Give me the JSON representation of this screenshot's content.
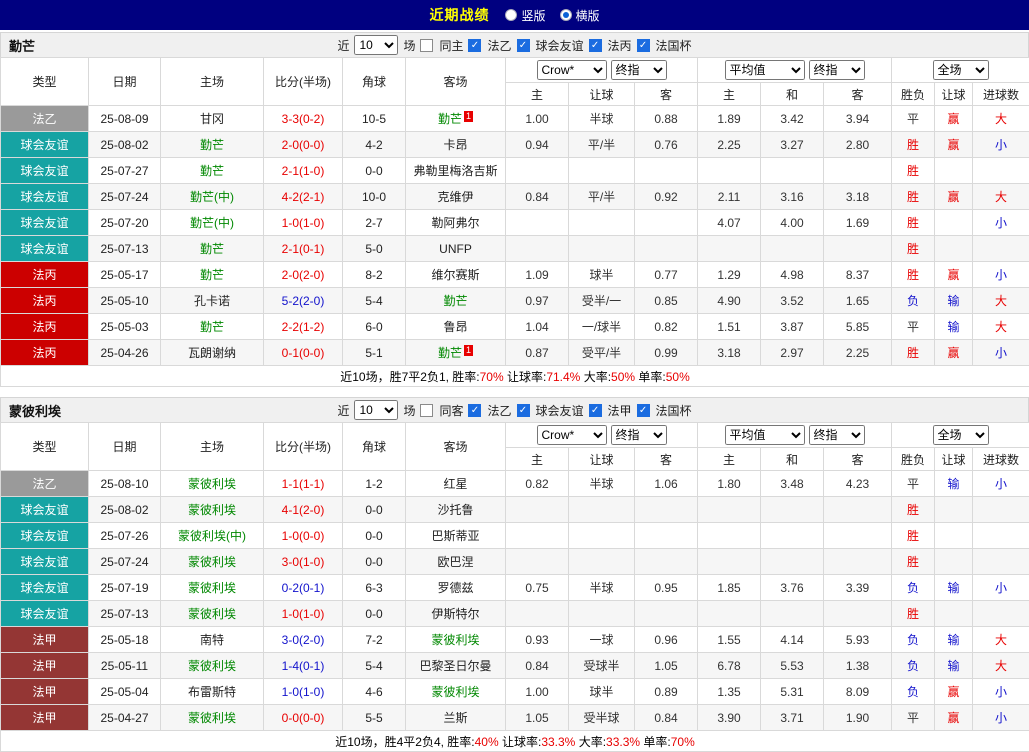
{
  "title_bar": {
    "title": "近期战绩",
    "view_options": [
      {
        "label": "竖版",
        "selected": false
      },
      {
        "label": "横版",
        "selected": true
      }
    ]
  },
  "colors": {
    "navy": "#000080",
    "title_yellow": "#ffff00",
    "red": "#e80000",
    "blue": "#1212cc",
    "green": "#008800",
    "league": {
      "法乙": "#9a9a9a",
      "球会友谊": "#16a3a3",
      "法丙": "#cc0000",
      "法甲": "#943634"
    }
  },
  "table_header": {
    "main_columns": [
      "类型",
      "日期",
      "主场",
      "比分(半场)",
      "角球",
      "客场"
    ],
    "sub_columns": [
      "主",
      "让球",
      "客",
      "主",
      "和",
      "客",
      "胜负",
      "让球",
      "进球数"
    ],
    "odds_selects_1": [
      "Crow*",
      "终指"
    ],
    "odds_selects_2": [
      "平均值",
      "终指"
    ],
    "odds_selects_3": [
      "全场"
    ]
  },
  "sections": [
    {
      "team": "勤芒",
      "filter": {
        "near_label": "近",
        "games": "10",
        "games_label": "场",
        "same_label": "同主",
        "same_checked": false,
        "leagues": [
          {
            "label": "法乙",
            "checked": true
          },
          {
            "label": "球会友谊",
            "checked": true
          },
          {
            "label": "法丙",
            "checked": true
          },
          {
            "label": "法国杯",
            "checked": true
          }
        ]
      },
      "rows": [
        {
          "league": "法乙",
          "date": "25-08-09",
          "home": "甘冈",
          "hf": false,
          "score": "3-3(0-2)",
          "corner": "10-5",
          "away": "勤芒",
          "af": true,
          "ac": "1",
          "o1": [
            "1.00",
            "半球",
            "0.88"
          ],
          "o2": [
            "1.89",
            "3.42",
            "3.94"
          ],
          "wdl": "平",
          "let": "赢",
          "goal": "大"
        },
        {
          "league": "球会友谊",
          "date": "25-08-02",
          "home": "勤芒",
          "hf": true,
          "score": "2-0(0-0)",
          "corner": "4-2",
          "away": "卡昂",
          "af": false,
          "o1": [
            "0.94",
            "平/半",
            "0.76"
          ],
          "o2": [
            "2.25",
            "3.27",
            "2.80"
          ],
          "wdl": "胜",
          "let": "赢",
          "goal": "小"
        },
        {
          "league": "球会友谊",
          "date": "25-07-27",
          "home": "勤芒",
          "hf": true,
          "score": "2-1(1-0)",
          "corner": "0-0",
          "away": "弗勒里梅洛吉斯",
          "af": false,
          "o1": [
            "",
            "",
            ""
          ],
          "o2": [
            "",
            "",
            ""
          ],
          "wdl": "胜",
          "let": "",
          "goal": ""
        },
        {
          "league": "球会友谊",
          "date": "25-07-24",
          "home": "勤芒(中)",
          "hf": true,
          "score": "4-2(2-1)",
          "corner": "10-0",
          "away": "克维伊",
          "af": false,
          "o1": [
            "0.84",
            "平/半",
            "0.92"
          ],
          "o2": [
            "2.11",
            "3.16",
            "3.18"
          ],
          "wdl": "胜",
          "let": "赢",
          "goal": "大"
        },
        {
          "league": "球会友谊",
          "date": "25-07-20",
          "home": "勤芒(中)",
          "hf": true,
          "score": "1-0(1-0)",
          "corner": "2-7",
          "away": "勒阿弗尔",
          "af": false,
          "o1": [
            "",
            "",
            ""
          ],
          "o2": [
            "4.07",
            "4.00",
            "1.69"
          ],
          "wdl": "胜",
          "let": "",
          "goal": "小"
        },
        {
          "league": "球会友谊",
          "date": "25-07-13",
          "home": "勤芒",
          "hf": true,
          "score": "2-1(0-1)",
          "corner": "5-0",
          "away": "UNFP",
          "af": false,
          "o1": [
            "",
            "",
            ""
          ],
          "o2": [
            "",
            "",
            ""
          ],
          "wdl": "胜",
          "let": "",
          "goal": ""
        },
        {
          "league": "法丙",
          "date": "25-05-17",
          "home": "勤芒",
          "hf": true,
          "score": "2-0(2-0)",
          "corner": "8-2",
          "away": "维尔赛斯",
          "af": false,
          "o1": [
            "1.09",
            "球半",
            "0.77"
          ],
          "o2": [
            "1.29",
            "4.98",
            "8.37"
          ],
          "wdl": "胜",
          "let": "赢",
          "goal": "小"
        },
        {
          "league": "法丙",
          "date": "25-05-10",
          "home": "孔卡诺",
          "hf": false,
          "score": "5-2(2-0)",
          "corner": "5-4",
          "away": "勤芒",
          "af": true,
          "o1": [
            "0.97",
            "受半/一",
            "0.85"
          ],
          "o2": [
            "4.90",
            "3.52",
            "1.65"
          ],
          "wdl": "负",
          "let": "输",
          "goal": "大"
        },
        {
          "league": "法丙",
          "date": "25-05-03",
          "home": "勤芒",
          "hf": true,
          "score": "2-2(1-2)",
          "corner": "6-0",
          "away": "鲁昂",
          "af": false,
          "o1": [
            "1.04",
            "一/球半",
            "0.82"
          ],
          "o2": [
            "1.51",
            "3.87",
            "5.85"
          ],
          "wdl": "平",
          "let": "输",
          "goal": "大"
        },
        {
          "league": "法丙",
          "date": "25-04-26",
          "home": "瓦朗谢纳",
          "hf": false,
          "score": "0-1(0-0)",
          "corner": "5-1",
          "away": "勤芒",
          "af": true,
          "ac": "1",
          "o1": [
            "0.87",
            "受平/半",
            "0.99"
          ],
          "o2": [
            "3.18",
            "2.97",
            "2.25"
          ],
          "wdl": "胜",
          "let": "赢",
          "goal": "小"
        }
      ],
      "summary": [
        {
          "text": "近10场，胜7平2负1, 胜率:",
          "type": "dark"
        },
        {
          "text": "70%",
          "type": "red"
        },
        {
          "text": " 让球率:",
          "type": "dark"
        },
        {
          "text": "71.4%",
          "type": "red"
        },
        {
          "text": " 大率:",
          "type": "dark"
        },
        {
          "text": "50%",
          "type": "red"
        },
        {
          "text": " 单率:",
          "type": "dark"
        },
        {
          "text": "50%",
          "type": "red"
        }
      ]
    },
    {
      "team": "蒙彼利埃",
      "filter": {
        "near_label": "近",
        "games": "10",
        "games_label": "场",
        "same_label": "同客",
        "same_checked": false,
        "leagues": [
          {
            "label": "法乙",
            "checked": true
          },
          {
            "label": "球会友谊",
            "checked": true
          },
          {
            "label": "法甲",
            "checked": true
          },
          {
            "label": "法国杯",
            "checked": true
          }
        ]
      },
      "rows": [
        {
          "league": "法乙",
          "date": "25-08-10",
          "home": "蒙彼利埃",
          "hf": true,
          "score": "1-1(1-1)",
          "corner": "1-2",
          "away": "红星",
          "af": false,
          "o1": [
            "0.82",
            "半球",
            "1.06"
          ],
          "o2": [
            "1.80",
            "3.48",
            "4.23"
          ],
          "wdl": "平",
          "let": "输",
          "goal": "小"
        },
        {
          "league": "球会友谊",
          "date": "25-08-02",
          "home": "蒙彼利埃",
          "hf": true,
          "score": "4-1(2-0)",
          "corner": "0-0",
          "away": "沙托鲁",
          "af": false,
          "o1": [
            "",
            "",
            ""
          ],
          "o2": [
            "",
            "",
            ""
          ],
          "wdl": "胜",
          "let": "",
          "goal": ""
        },
        {
          "league": "球会友谊",
          "date": "25-07-26",
          "home": "蒙彼利埃(中)",
          "hf": true,
          "score": "1-0(0-0)",
          "corner": "0-0",
          "away": "巴斯蒂亚",
          "af": false,
          "o1": [
            "",
            "",
            ""
          ],
          "o2": [
            "",
            "",
            ""
          ],
          "wdl": "胜",
          "let": "",
          "goal": ""
        },
        {
          "league": "球会友谊",
          "date": "25-07-24",
          "home": "蒙彼利埃",
          "hf": true,
          "score": "3-0(1-0)",
          "corner": "0-0",
          "away": "欧巴涅",
          "af": false,
          "o1": [
            "",
            "",
            ""
          ],
          "o2": [
            "",
            "",
            ""
          ],
          "wdl": "胜",
          "let": "",
          "goal": ""
        },
        {
          "league": "球会友谊",
          "date": "25-07-19",
          "home": "蒙彼利埃",
          "hf": true,
          "score": "0-2(0-1)",
          "corner": "6-3",
          "away": "罗德兹",
          "af": false,
          "o1": [
            "0.75",
            "半球",
            "0.95"
          ],
          "o2": [
            "1.85",
            "3.76",
            "3.39"
          ],
          "wdl": "负",
          "let": "输",
          "goal": "小"
        },
        {
          "league": "球会友谊",
          "date": "25-07-13",
          "home": "蒙彼利埃",
          "hf": true,
          "score": "1-0(1-0)",
          "corner": "0-0",
          "away": "伊斯特尔",
          "af": false,
          "o1": [
            "",
            "",
            ""
          ],
          "o2": [
            "",
            "",
            ""
          ],
          "wdl": "胜",
          "let": "",
          "goal": ""
        },
        {
          "league": "法甲",
          "date": "25-05-18",
          "home": "南特",
          "hf": false,
          "score": "3-0(2-0)",
          "corner": "7-2",
          "away": "蒙彼利埃",
          "af": true,
          "o1": [
            "0.93",
            "一球",
            "0.96"
          ],
          "o2": [
            "1.55",
            "4.14",
            "5.93"
          ],
          "wdl": "负",
          "let": "输",
          "goal": "大"
        },
        {
          "league": "法甲",
          "date": "25-05-11",
          "home": "蒙彼利埃",
          "hf": true,
          "score": "1-4(0-1)",
          "corner": "5-4",
          "away": "巴黎圣日尔曼",
          "af": false,
          "o1": [
            "0.84",
            "受球半",
            "1.05"
          ],
          "o2": [
            "6.78",
            "5.53",
            "1.38"
          ],
          "wdl": "负",
          "let": "输",
          "goal": "大"
        },
        {
          "league": "法甲",
          "date": "25-05-04",
          "home": "布雷斯特",
          "hf": false,
          "score": "1-0(1-0)",
          "corner": "4-6",
          "away": "蒙彼利埃",
          "af": true,
          "o1": [
            "1.00",
            "球半",
            "0.89"
          ],
          "o2": [
            "1.35",
            "5.31",
            "8.09"
          ],
          "wdl": "负",
          "let": "赢",
          "goal": "小"
        },
        {
          "league": "法甲",
          "date": "25-04-27",
          "home": "蒙彼利埃",
          "hf": true,
          "score": "0-0(0-0)",
          "corner": "5-5",
          "away": "兰斯",
          "af": false,
          "o1": [
            "1.05",
            "受半球",
            "0.84"
          ],
          "o2": [
            "3.90",
            "3.71",
            "1.90"
          ],
          "wdl": "平",
          "let": "赢",
          "goal": "小"
        }
      ],
      "summary": [
        {
          "text": "近10场，胜4平2负4, 胜率:",
          "type": "dark"
        },
        {
          "text": "40%",
          "type": "red"
        },
        {
          "text": " 让球率:",
          "type": "dark"
        },
        {
          "text": "33.3%",
          "type": "red"
        },
        {
          "text": " 大率:",
          "type": "dark"
        },
        {
          "text": "33.3%",
          "type": "red"
        },
        {
          "text": " 单率:",
          "type": "dark"
        },
        {
          "text": "70%",
          "type": "red"
        }
      ]
    }
  ]
}
